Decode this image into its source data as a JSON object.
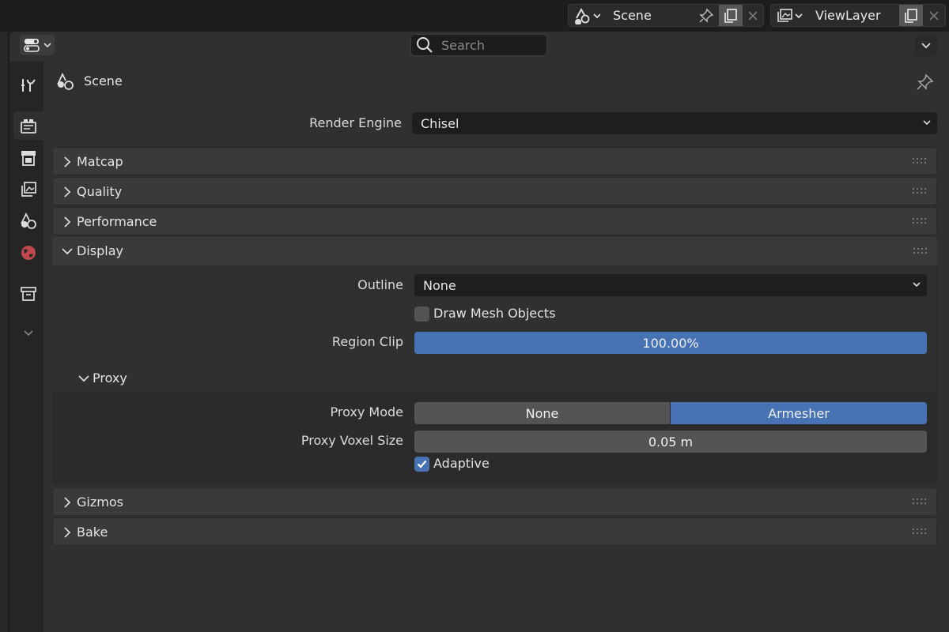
{
  "topbar": {
    "scene_name": "Scene",
    "view_layer_name": "ViewLayer"
  },
  "search": {
    "placeholder": "Search"
  },
  "context": {
    "title": "Scene"
  },
  "render": {
    "label": "Render Engine",
    "value": "Chisel"
  },
  "sections": {
    "matcap": "Matcap",
    "quality": "Quality",
    "performance": "Performance",
    "display": "Display",
    "gizmos": "Gizmos",
    "bake": "Bake"
  },
  "display": {
    "outline_label": "Outline",
    "outline_value": "None",
    "draw_mesh_label": "Draw Mesh Objects",
    "draw_mesh_checked": false,
    "region_clip_label": "Region Clip",
    "region_clip_value": "100.00%",
    "region_clip_fraction": 1.0
  },
  "proxy": {
    "title": "Proxy",
    "mode_label": "Proxy Mode",
    "mode_options": [
      "None",
      "Armesher"
    ],
    "mode_selected": "Armesher",
    "voxel_label": "Proxy Voxel Size",
    "voxel_value": "0.05 m",
    "adaptive_label": "Adaptive",
    "adaptive_checked": true
  },
  "colors": {
    "accent": "#4772b3",
    "panel": "#303030",
    "section": "#3a3a3a",
    "world_tab_icon": "#c0474b"
  },
  "icons": {
    "tabs": [
      "tool-icon",
      "render-icon",
      "output-icon",
      "view-layer-icon",
      "scene-icon",
      "world-icon",
      "collection-icon",
      "chevron-down-icon"
    ]
  }
}
